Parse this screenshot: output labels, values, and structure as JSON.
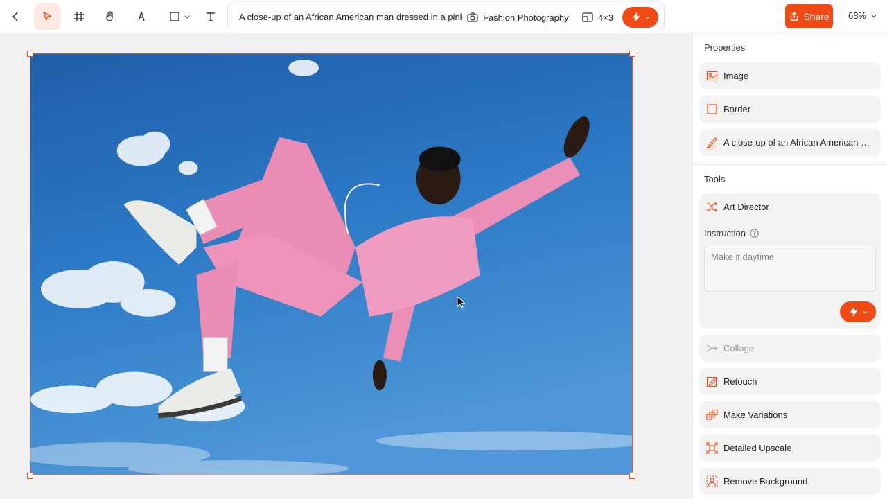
{
  "toolbar": {
    "prompt": "A close-up of an African American man dressed in a pink",
    "style_label": "Fashion Photography",
    "ratio_label": "4×3",
    "share_label": "Share",
    "zoom": "68%"
  },
  "properties": {
    "title": "Properties",
    "items": [
      {
        "label": "Image",
        "icon": "image-icon"
      },
      {
        "label": "Border",
        "icon": "square-icon"
      },
      {
        "label": "A close-up of an African American man dressed in a pink",
        "icon": "pen-icon"
      }
    ]
  },
  "tools": {
    "title": "Tools",
    "art_director": {
      "label": "Art Director",
      "instruction_label": "Instruction",
      "instruction_placeholder": "Make it daytime"
    },
    "items": [
      {
        "label": "Collage",
        "icon": "collage-icon",
        "disabled": true
      },
      {
        "label": "Retouch",
        "icon": "retouch-icon"
      },
      {
        "label": "Make Variations",
        "icon": "variations-icon"
      },
      {
        "label": "Detailed Upscale",
        "icon": "upscale-icon"
      },
      {
        "label": "Remove Background",
        "icon": "remove-bg-icon"
      }
    ]
  },
  "colors": {
    "accent": "#f24a14",
    "selection": "#e0552d"
  }
}
